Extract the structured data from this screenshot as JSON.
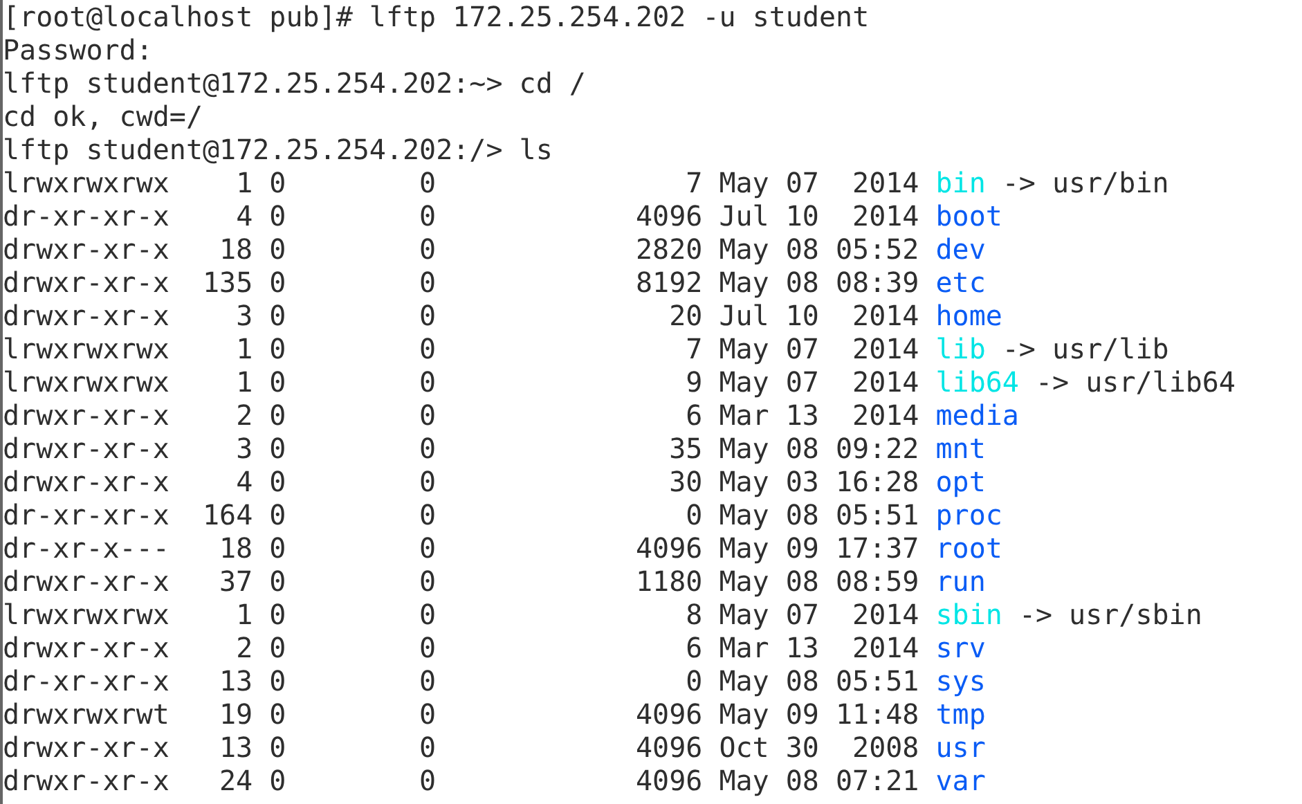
{
  "lines": [
    "[root@localhost pub]# lftp 172.25.254.202 -u student",
    "Password:",
    "lftp student@172.25.254.202:~> cd /",
    "cd ok, cwd=/",
    "lftp student@172.25.254.202:/> ls"
  ],
  "entries": [
    {
      "perms": "lrwxrwxrwx",
      "links": "1",
      "owner": "0",
      "group": "0",
      "size": "7",
      "date": "May 07  2014",
      "name": "bin",
      "kind": "link",
      "target": "-> usr/bin"
    },
    {
      "perms": "dr-xr-xr-x",
      "links": "4",
      "owner": "0",
      "group": "0",
      "size": "4096",
      "date": "Jul 10  2014",
      "name": "boot",
      "kind": "dir"
    },
    {
      "perms": "drwxr-xr-x",
      "links": "18",
      "owner": "0",
      "group": "0",
      "size": "2820",
      "date": "May 08 05:52",
      "name": "dev",
      "kind": "dir"
    },
    {
      "perms": "drwxr-xr-x",
      "links": "135",
      "owner": "0",
      "group": "0",
      "size": "8192",
      "date": "May 08 08:39",
      "name": "etc",
      "kind": "dir"
    },
    {
      "perms": "drwxr-xr-x",
      "links": "3",
      "owner": "0",
      "group": "0",
      "size": "20",
      "date": "Jul 10  2014",
      "name": "home",
      "kind": "dir"
    },
    {
      "perms": "lrwxrwxrwx",
      "links": "1",
      "owner": "0",
      "group": "0",
      "size": "7",
      "date": "May 07  2014",
      "name": "lib",
      "kind": "link",
      "target": "-> usr/lib"
    },
    {
      "perms": "lrwxrwxrwx",
      "links": "1",
      "owner": "0",
      "group": "0",
      "size": "9",
      "date": "May 07  2014",
      "name": "lib64",
      "kind": "link",
      "target": "-> usr/lib64"
    },
    {
      "perms": "drwxr-xr-x",
      "links": "2",
      "owner": "0",
      "group": "0",
      "size": "6",
      "date": "Mar 13  2014",
      "name": "media",
      "kind": "dir"
    },
    {
      "perms": "drwxr-xr-x",
      "links": "3",
      "owner": "0",
      "group": "0",
      "size": "35",
      "date": "May 08 09:22",
      "name": "mnt",
      "kind": "dir"
    },
    {
      "perms": "drwxr-xr-x",
      "links": "4",
      "owner": "0",
      "group": "0",
      "size": "30",
      "date": "May 03 16:28",
      "name": "opt",
      "kind": "dir"
    },
    {
      "perms": "dr-xr-xr-x",
      "links": "164",
      "owner": "0",
      "group": "0",
      "size": "0",
      "date": "May 08 05:51",
      "name": "proc",
      "kind": "dir"
    },
    {
      "perms": "dr-xr-x---",
      "links": "18",
      "owner": "0",
      "group": "0",
      "size": "4096",
      "date": "May 09 17:37",
      "name": "root",
      "kind": "dir"
    },
    {
      "perms": "drwxr-xr-x",
      "links": "37",
      "owner": "0",
      "group": "0",
      "size": "1180",
      "date": "May 08 08:59",
      "name": "run",
      "kind": "dir"
    },
    {
      "perms": "lrwxrwxrwx",
      "links": "1",
      "owner": "0",
      "group": "0",
      "size": "8",
      "date": "May 07  2014",
      "name": "sbin",
      "kind": "link",
      "target": "-> usr/sbin"
    },
    {
      "perms": "drwxr-xr-x",
      "links": "2",
      "owner": "0",
      "group": "0",
      "size": "6",
      "date": "Mar 13  2014",
      "name": "srv",
      "kind": "dir"
    },
    {
      "perms": "dr-xr-xr-x",
      "links": "13",
      "owner": "0",
      "group": "0",
      "size": "0",
      "date": "May 08 05:51",
      "name": "sys",
      "kind": "dir"
    },
    {
      "perms": "drwxrwxrwt",
      "links": "19",
      "owner": "0",
      "group": "0",
      "size": "4096",
      "date": "May 09 11:48",
      "name": "tmp",
      "kind": "dir"
    },
    {
      "perms": "drwxr-xr-x",
      "links": "13",
      "owner": "0",
      "group": "0",
      "size": "4096",
      "date": "Oct 30  2008",
      "name": "usr",
      "kind": "dir"
    },
    {
      "perms": "drwxr-xr-x",
      "links": "24",
      "owner": "0",
      "group": "0",
      "size": "4096",
      "date": "May 08 07:21",
      "name": "var",
      "kind": "dir"
    }
  ]
}
